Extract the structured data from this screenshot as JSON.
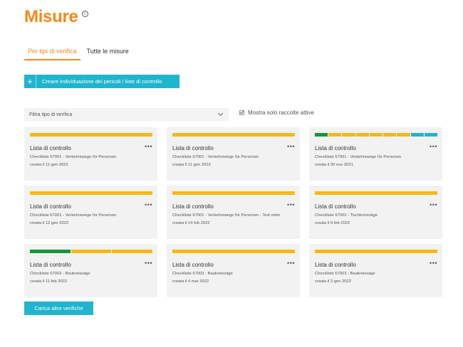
{
  "header": {
    "title": "Misure",
    "info_icon": "info-icon"
  },
  "tabs": [
    {
      "label": "Per tipi di verifica",
      "active": true
    },
    {
      "label": "Tutte le misure",
      "active": false
    }
  ],
  "create_button": {
    "icon": "plus-icon",
    "label": "Creare individuazione dei pericoli / liste di controllo"
  },
  "filter": {
    "placeholder": "Filtra tipo di verifica",
    "icon": "chevron-down-icon"
  },
  "active_only": {
    "label": "Mostra solo raccolte attive",
    "checked": true
  },
  "colors": {
    "accent": "#f08a1c",
    "primary": "#1fb5cc",
    "yellow": "#f5b816",
    "green": "#14963c",
    "teal": "#1fb5cc"
  },
  "cards": [
    {
      "title": "Lista di controllo",
      "menu": "•••",
      "subtitle": "Checkliste 67001 - Verkehrswege für Personen",
      "date": "creata il 11 gen 2022",
      "progress": [
        "yellow"
      ]
    },
    {
      "title": "Lista di controllo",
      "menu": "•••",
      "subtitle": "Checkliste 67001 - Verkehrswege für Personen",
      "date": "creata il 11 gen 2022",
      "progress": [
        "yellow"
      ]
    },
    {
      "title": "Lista di controllo",
      "menu": "•••",
      "subtitle": "Checkliste 67001 - Verkehrswege für Personen",
      "date": "creata il 30 nov 2021",
      "progress": [
        "green",
        "yellow",
        "yellow",
        "yellow",
        "yellow",
        "yellow",
        "yellow",
        "teal",
        "teal"
      ]
    },
    {
      "title": "Lista di controllo",
      "menu": "•••",
      "subtitle": "Checkliste 67001 - Verkehrswege für Personen",
      "date": "creata il 12 gen 2022",
      "progress": [
        "yellow"
      ]
    },
    {
      "title": "Lista di controllo",
      "menu": "•••",
      "subtitle": "Checkliste 67001 - Verkehrswege für Personen - Test mdm",
      "date": "creata il 14 feb 2022",
      "progress": [
        "yellow"
      ]
    },
    {
      "title": "Lista di controllo",
      "menu": "•••",
      "subtitle": "Checkliste 67002 - Tischkreissäge",
      "date": "creata il 9 feb 2022",
      "progress": [
        "yellow"
      ]
    },
    {
      "title": "Lista di controllo",
      "menu": "•••",
      "subtitle": "Checkliste 67003 - Baukreissäge",
      "date": "creata il 11 feb 2022",
      "progress": [
        "green",
        "yellow",
        "yellow"
      ]
    },
    {
      "title": "Lista di controllo",
      "menu": "•••",
      "subtitle": "Checkliste 67003 - Baukreissäge",
      "date": "creata il 4 mar 2022",
      "progress": [
        "yellow"
      ]
    },
    {
      "title": "Lista di controllo",
      "menu": "•••",
      "subtitle": "Checkliste 67003 - Baukreissäge",
      "date": "creata il 3 gen 2022",
      "progress": [
        "yellow"
      ]
    }
  ],
  "load_more": {
    "label": "Carica altre verifiche"
  }
}
